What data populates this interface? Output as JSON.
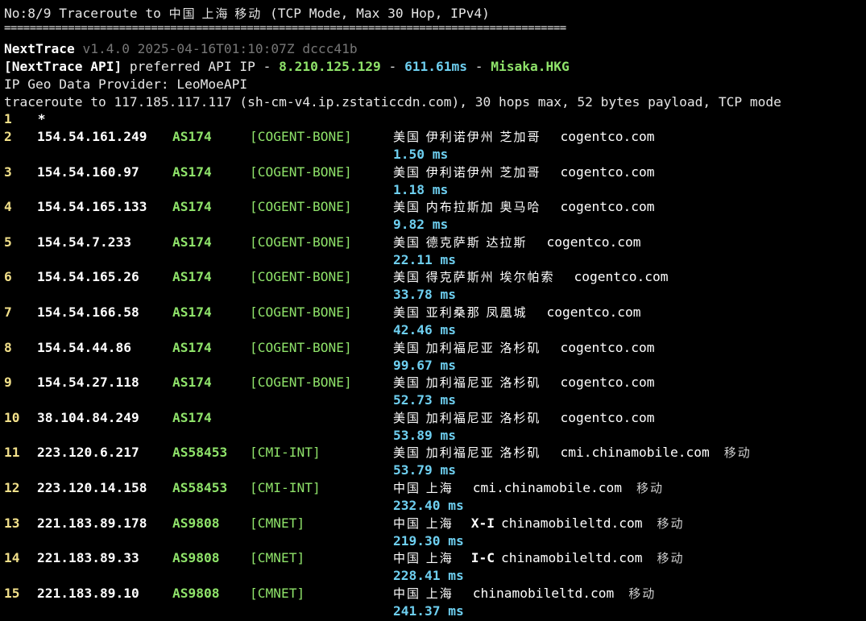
{
  "header": {
    "title_prefix": "No:8/9 Traceroute to ",
    "title_cjk": "中国 上海 移动",
    "title_suffix": " (TCP Mode, Max 30 Hop, IPv4)",
    "separator": "========================================================================================",
    "app_name": "NextTrace",
    "version_line": " v1.4.0 2025-04-16T01:10:07Z dccc41b",
    "api_label": "[NextTrace API]",
    "api_text": " preferred API IP - ",
    "api_ip": "8.210.125.129",
    "api_dash1": " - ",
    "api_latency": "611.61ms",
    "api_dash2": " - ",
    "api_node": "Misaka.HKG",
    "geo_provider": "IP Geo Data Provider: LeoMoeAPI",
    "traceroute_line": "traceroute to 117.185.117.117 (sh-cm-v4.ip.zstaticcdn.com), 30 hops max, 52 bytes payload, TCP mode"
  },
  "hop1": {
    "num": "1",
    "star": "*"
  },
  "hops": [
    {
      "num": "2",
      "ip": "154.54.161.249",
      "asn": "AS174",
      "tag": "[COGENT-BONE]",
      "geo": "美国 伊利诺伊州 芝加哥",
      "code": "",
      "rdns": "cogentco.com",
      "isp": "",
      "rtt": "1.50 ms"
    },
    {
      "num": "3",
      "ip": "154.54.160.97",
      "asn": "AS174",
      "tag": "[COGENT-BONE]",
      "geo": "美国 伊利诺伊州 芝加哥",
      "code": "",
      "rdns": "cogentco.com",
      "isp": "",
      "rtt": "1.18 ms"
    },
    {
      "num": "4",
      "ip": "154.54.165.133",
      "asn": "AS174",
      "tag": "[COGENT-BONE]",
      "geo": "美国 内布拉斯加 奥马哈",
      "code": "",
      "rdns": "cogentco.com",
      "isp": "",
      "rtt": "9.82 ms"
    },
    {
      "num": "5",
      "ip": "154.54.7.233",
      "asn": "AS174",
      "tag": "[COGENT-BONE]",
      "geo": "美国 德克萨斯 达拉斯",
      "code": "",
      "rdns": "cogentco.com",
      "isp": "",
      "rtt": "22.11 ms"
    },
    {
      "num": "6",
      "ip": "154.54.165.26",
      "asn": "AS174",
      "tag": "[COGENT-BONE]",
      "geo": "美国 得克萨斯州 埃尔帕索",
      "code": "",
      "rdns": "cogentco.com",
      "isp": "",
      "rtt": "33.78 ms"
    },
    {
      "num": "7",
      "ip": "154.54.166.58",
      "asn": "AS174",
      "tag": "[COGENT-BONE]",
      "geo": "美国 亚利桑那 凤凰城",
      "code": "",
      "rdns": "cogentco.com",
      "isp": "",
      "rtt": "42.46 ms"
    },
    {
      "num": "8",
      "ip": "154.54.44.86",
      "asn": "AS174",
      "tag": "[COGENT-BONE]",
      "geo": "美国 加利福尼亚 洛杉矶",
      "code": "",
      "rdns": "cogentco.com",
      "isp": "",
      "rtt": "99.67 ms"
    },
    {
      "num": "9",
      "ip": "154.54.27.118",
      "asn": "AS174",
      "tag": "[COGENT-BONE]",
      "geo": "美国 加利福尼亚 洛杉矶",
      "code": "",
      "rdns": "cogentco.com",
      "isp": "",
      "rtt": "52.73 ms"
    },
    {
      "num": "10",
      "ip": "38.104.84.249",
      "asn": "AS174",
      "tag": "",
      "geo": "美国 加利福尼亚 洛杉矶",
      "code": "",
      "rdns": "cogentco.com",
      "isp": "",
      "rtt": "53.89 ms"
    },
    {
      "num": "11",
      "ip": "223.120.6.217",
      "asn": "AS58453",
      "tag": "[CMI-INT]",
      "geo": "美国 加利福尼亚 洛杉矶",
      "code": "",
      "rdns": "cmi.chinamobile.com",
      "isp": "移动",
      "rtt": "53.79 ms"
    },
    {
      "num": "12",
      "ip": "223.120.14.158",
      "asn": "AS58453",
      "tag": "[CMI-INT]",
      "geo": "中国 上海",
      "code": "",
      "rdns": "cmi.chinamobile.com",
      "isp": "移动",
      "rtt": "232.40 ms"
    },
    {
      "num": "13",
      "ip": "221.183.89.178",
      "asn": "AS9808",
      "tag": "[CMNET]",
      "geo": "中国 上海",
      "code": "X-I",
      "rdns": "chinamobileltd.com",
      "isp": "移动",
      "rtt": "219.30 ms"
    },
    {
      "num": "14",
      "ip": "221.183.89.33",
      "asn": "AS9808",
      "tag": "[CMNET]",
      "geo": "中国 上海",
      "code": "I-C",
      "rdns": "chinamobileltd.com",
      "isp": "移动",
      "rtt": "228.41 ms"
    },
    {
      "num": "15",
      "ip": "221.183.89.10",
      "asn": "AS9808",
      "tag": "[CMNET]",
      "geo": "中国 上海",
      "code": "",
      "rdns": "chinamobileltd.com",
      "isp": "移动",
      "rtt": "241.37 ms"
    }
  ],
  "colors": {
    "background": "#000000",
    "asn_green": "#8fe36a",
    "rtt_cyan": "#6ecff0",
    "hop_number": "#f2e08a"
  }
}
